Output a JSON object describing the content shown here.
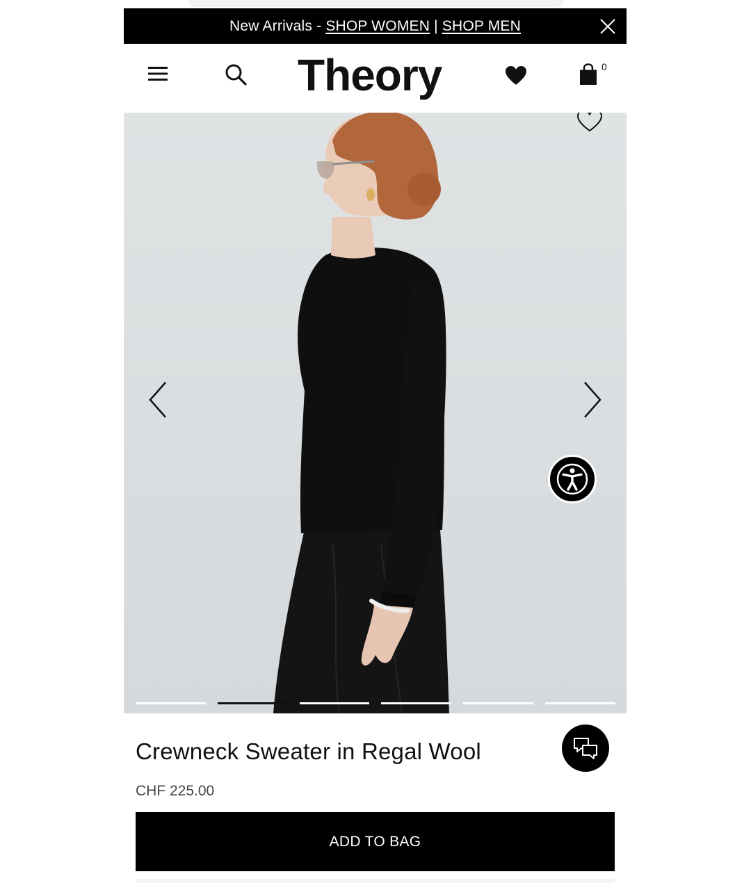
{
  "promo": {
    "prefix": "New Arrivals -",
    "link_women": "SHOP WOMEN",
    "separator": "|",
    "link_men": "SHOP MEN",
    "close_icon": "close-icon"
  },
  "header": {
    "menu_icon": "hamburger-menu-icon",
    "search_icon": "search-icon",
    "logo": "Theory",
    "wishlist_icon": "heart-icon",
    "bag_icon": "shopping-bag-icon",
    "bag_count": "0"
  },
  "gallery": {
    "prev_icon": "chevron-left-icon",
    "next_icon": "chevron-right-icon",
    "wishlist_icon": "heart-outline-icon",
    "accessibility_icon": "accessibility-icon",
    "slide_count": 6,
    "active_slide": 2
  },
  "product": {
    "title": "Crewneck Sweater in Regal Wool",
    "price": "CHF 225.00",
    "add_to_bag": "ADD TO BAG",
    "chat_icon": "chat-icon"
  },
  "colors": {
    "brand_black": "#000000",
    "background": "#ffffff",
    "hero_bg": "#dcdfe0"
  }
}
